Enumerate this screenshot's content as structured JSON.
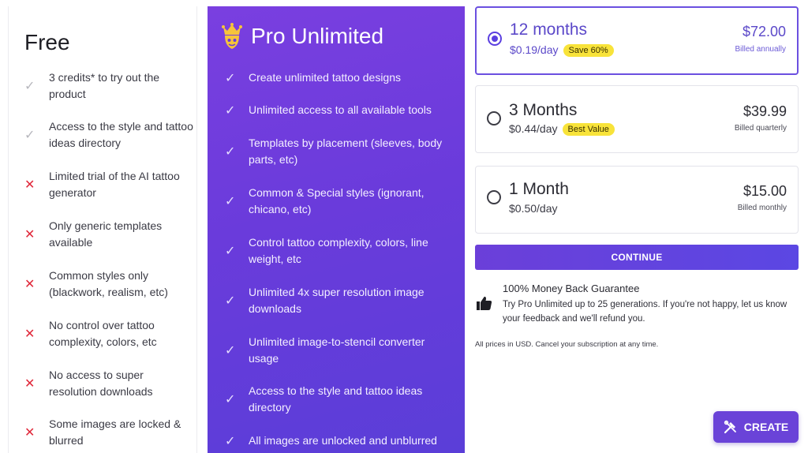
{
  "free": {
    "title": "Free",
    "features": [
      {
        "icon": "check-icon",
        "text": "3 credits* to try out the product"
      },
      {
        "icon": "check-icon",
        "text": "Access to the style and tattoo ideas directory"
      },
      {
        "icon": "cross-icon",
        "text": "Limited trial of the AI tattoo generator"
      },
      {
        "icon": "cross-icon",
        "text": "Only generic templates available"
      },
      {
        "icon": "cross-icon",
        "text": "Common styles only (blackwork, realism, etc)"
      },
      {
        "icon": "cross-icon",
        "text": "No control over tattoo complexity, colors, etc"
      },
      {
        "icon": "cross-icon",
        "text": "No access to super resolution downloads"
      },
      {
        "icon": "cross-icon",
        "text": "Some images are locked & blurred"
      }
    ]
  },
  "pro": {
    "title": "Pro Unlimited",
    "features": [
      "Create unlimited tattoo designs",
      "Unlimited access to all available tools",
      "Templates by placement (sleeves, body parts, etc)",
      "Common & Special styles (ignorant, chicano, etc)",
      "Control tattoo complexity, colors, line weight, etc",
      "Unlimited 4x super resolution image downloads",
      "Unlimited image-to-stencil converter usage",
      "Access to the style and tattoo ideas directory",
      "All images are unlocked and unblurred"
    ]
  },
  "plans": [
    {
      "name": "12 months",
      "per_day": "$0.19/day",
      "badge": "Save 60%",
      "price": "$72.00",
      "billed": "Billed annually",
      "selected": true
    },
    {
      "name": "3 Months",
      "per_day": "$0.44/day",
      "badge": "Best Value",
      "price": "$39.99",
      "billed": "Billed quarterly",
      "selected": false
    },
    {
      "name": "1 Month",
      "per_day": "$0.50/day",
      "badge": "",
      "price": "$15.00",
      "billed": "Billed monthly",
      "selected": false
    }
  ],
  "continue_label": "CONTINUE",
  "guarantee": {
    "title": "100% Money Back Guarantee",
    "text": "Try Pro Unlimited up to 25 generations. If you're not happy, let us know your feedback and we'll refund you."
  },
  "prices_note": "All prices in USD. Cancel your subscription at any time.",
  "create_label": "CREATE",
  "colors": {
    "accent": "#6a43d8",
    "badge": "#f8e33a",
    "cross": "#e0283a"
  }
}
